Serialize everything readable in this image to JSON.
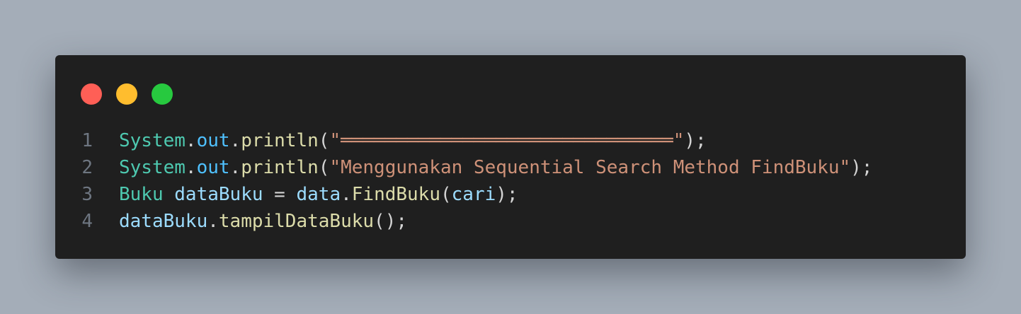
{
  "window_controls": [
    {
      "name": "close-dot",
      "color": "#ff5f56"
    },
    {
      "name": "minimize-dot",
      "color": "#ffbd2e"
    },
    {
      "name": "maximize-dot",
      "color": "#27c93f"
    }
  ],
  "colors": {
    "class": "#4ec9b0",
    "field": "#4fc1ff",
    "method": "#dcdcaa",
    "string": "#ce9178",
    "variable": "#9cdcfe",
    "punct": "#d4d4d4",
    "line_number": "#6e7681"
  },
  "code": [
    {
      "number": "1",
      "tokens": [
        {
          "text": "System",
          "type": "class"
        },
        {
          "text": ".",
          "type": "punct"
        },
        {
          "text": "out",
          "type": "field"
        },
        {
          "text": ".",
          "type": "punct"
        },
        {
          "text": "println",
          "type": "method"
        },
        {
          "text": "(",
          "type": "punct"
        },
        {
          "text": "\"══════════════════════════════\"",
          "type": "string"
        },
        {
          "text": ");",
          "type": "punct"
        }
      ]
    },
    {
      "number": "2",
      "tokens": [
        {
          "text": "System",
          "type": "class"
        },
        {
          "text": ".",
          "type": "punct"
        },
        {
          "text": "out",
          "type": "field"
        },
        {
          "text": ".",
          "type": "punct"
        },
        {
          "text": "println",
          "type": "method"
        },
        {
          "text": "(",
          "type": "punct"
        },
        {
          "text": "\"Menggunakan Sequential Search Method FindBuku\"",
          "type": "string"
        },
        {
          "text": ");",
          "type": "punct"
        }
      ]
    },
    {
      "number": "3",
      "tokens": [
        {
          "text": "Buku",
          "type": "class"
        },
        {
          "text": " ",
          "type": "punct"
        },
        {
          "text": "dataBuku",
          "type": "variable"
        },
        {
          "text": " = ",
          "type": "punct"
        },
        {
          "text": "data",
          "type": "variable"
        },
        {
          "text": ".",
          "type": "punct"
        },
        {
          "text": "FindBuku",
          "type": "method"
        },
        {
          "text": "(",
          "type": "punct"
        },
        {
          "text": "cari",
          "type": "variable"
        },
        {
          "text": ");",
          "type": "punct"
        }
      ]
    },
    {
      "number": "4",
      "tokens": [
        {
          "text": "dataBuku",
          "type": "variable"
        },
        {
          "text": ".",
          "type": "punct"
        },
        {
          "text": "tampilDataBuku",
          "type": "method"
        },
        {
          "text": "();",
          "type": "punct"
        }
      ]
    }
  ]
}
